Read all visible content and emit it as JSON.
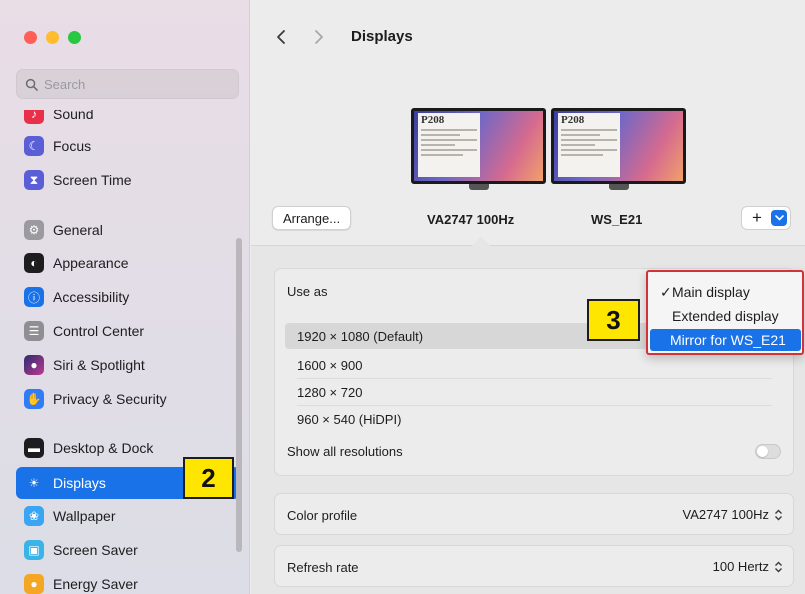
{
  "window": {
    "title": "Displays"
  },
  "search": {
    "placeholder": "Search"
  },
  "sidebar": {
    "items": [
      {
        "label": "Sound",
        "icon": "speaker-icon",
        "color": "#e8304b"
      },
      {
        "label": "Focus",
        "icon": "moon-icon",
        "color": "#5b5fd6"
      },
      {
        "label": "Screen Time",
        "icon": "hourglass-icon",
        "color": "#5b5fd6"
      },
      {
        "label": "General",
        "icon": "gear-icon",
        "color": "#9a9aa0"
      },
      {
        "label": "Appearance",
        "icon": "appearance-icon",
        "color": "#1d1d1f"
      },
      {
        "label": "Accessibility",
        "icon": "accessibility-icon",
        "color": "#1a72e8"
      },
      {
        "label": "Control Center",
        "icon": "toggles-icon",
        "color": "#8e8e93"
      },
      {
        "label": "Siri & Spotlight",
        "icon": "siri-icon",
        "color": "#2b2b6e"
      },
      {
        "label": "Privacy & Security",
        "icon": "hand-icon",
        "color": "#2f7cf6"
      },
      {
        "label": "Desktop & Dock",
        "icon": "dock-icon",
        "color": "#1d1d1f"
      },
      {
        "label": "Displays",
        "icon": "sun-icon",
        "color": "#1a72e8"
      },
      {
        "label": "Wallpaper",
        "icon": "flower-icon",
        "color": "#3aa5f2"
      },
      {
        "label": "Screen Saver",
        "icon": "screensaver-icon",
        "color": "#3ab4e8"
      },
      {
        "label": "Energy Saver",
        "icon": "bulb-icon",
        "color": "#f5a623"
      }
    ]
  },
  "callouts": {
    "first": "2",
    "second": "3"
  },
  "monitors": [
    {
      "screen_text": "P208",
      "name": "VA2747 100Hz"
    },
    {
      "screen_text": "P208",
      "name": "WS_E21"
    }
  ],
  "buttons": {
    "arrange": "Arrange...",
    "add": "+"
  },
  "use_as": {
    "label": "Use as"
  },
  "resolutions": [
    "1920 × 1080 (Default)",
    "1600 × 900",
    "1280 × 720",
    "960 × 540 (HiDPI)"
  ],
  "show_all": {
    "label": "Show all resolutions"
  },
  "color_profile": {
    "label": "Color profile",
    "value": "VA2747 100Hz"
  },
  "refresh_rate": {
    "label": "Refresh rate",
    "value": "100 Hertz"
  },
  "popup": {
    "check": "✓",
    "items": [
      "Main display",
      "Extended display",
      "Mirror for WS_E21"
    ]
  },
  "colors": {
    "accent": "#1a72e8",
    "callout": "#ffe600",
    "popup_border": "#d2333b"
  }
}
